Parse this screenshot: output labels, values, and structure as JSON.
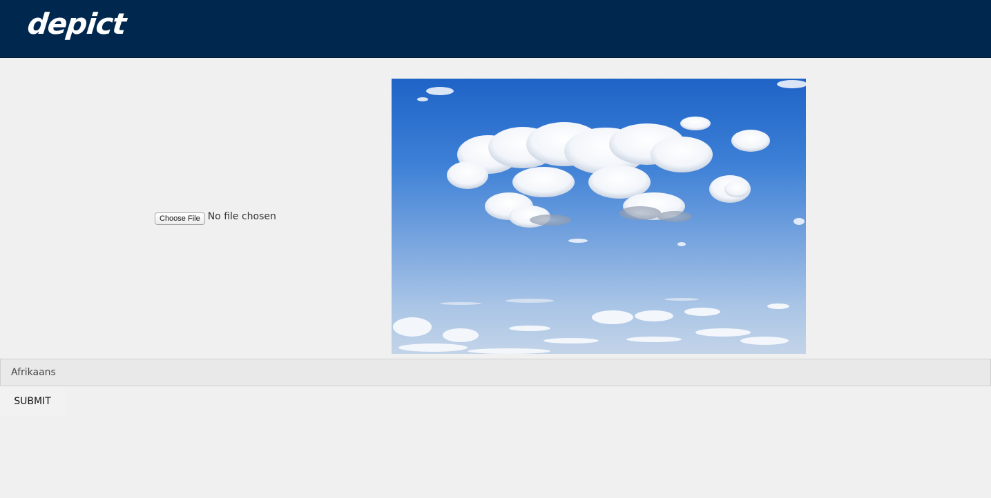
{
  "header": {
    "logo_text": "depict",
    "background_color": "#00284f"
  },
  "upload": {
    "button_label": "Choose File",
    "status_text": "No file chosen"
  },
  "preview": {
    "description_icon": "sky-clouds-photo"
  },
  "language": {
    "selected": "Afrikaans"
  },
  "form": {
    "submit_label": "SUBMIT"
  }
}
